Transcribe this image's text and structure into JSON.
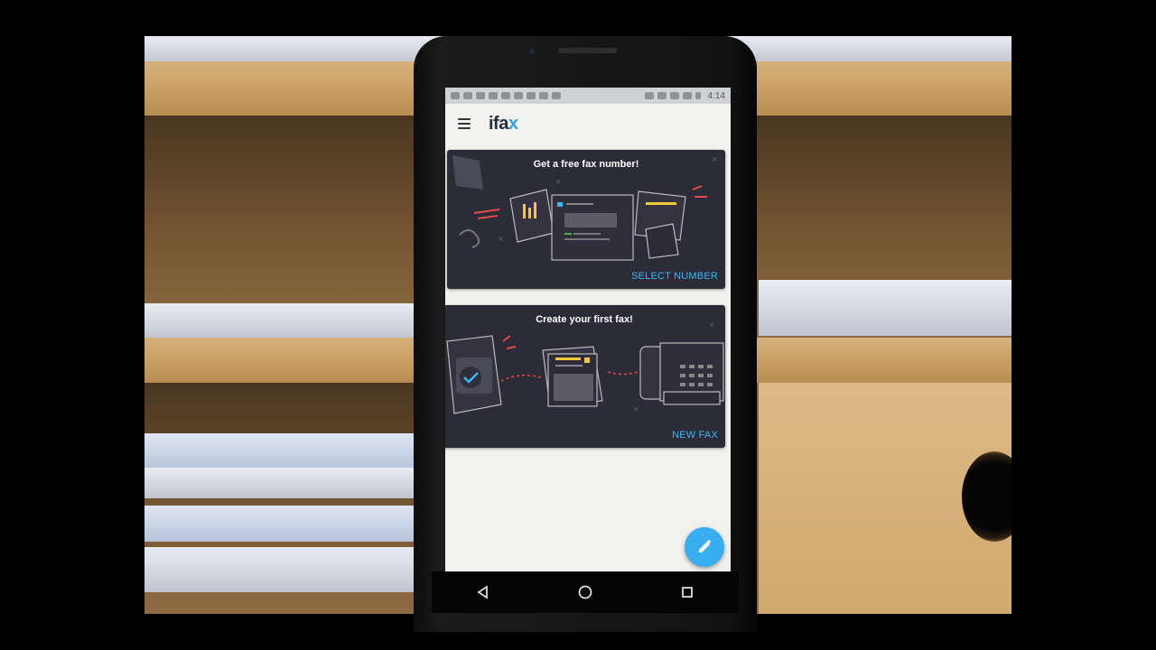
{
  "app": {
    "logo_main": "ifa",
    "logo_accent": "x",
    "accent_color": "#2aa4e8"
  },
  "status_bar": {
    "time": "4:14"
  },
  "cards": [
    {
      "title": "Get a free fax number!",
      "action": "SELECT NUMBER"
    },
    {
      "title": "Create your first fax!",
      "action": "NEW FAX"
    }
  ],
  "icons": {
    "menu": "hamburger-menu-icon",
    "fab": "pencil-icon",
    "nav_back": "back-triangle-icon",
    "nav_home": "home-circle-icon",
    "nav_recents": "recents-square-icon"
  }
}
